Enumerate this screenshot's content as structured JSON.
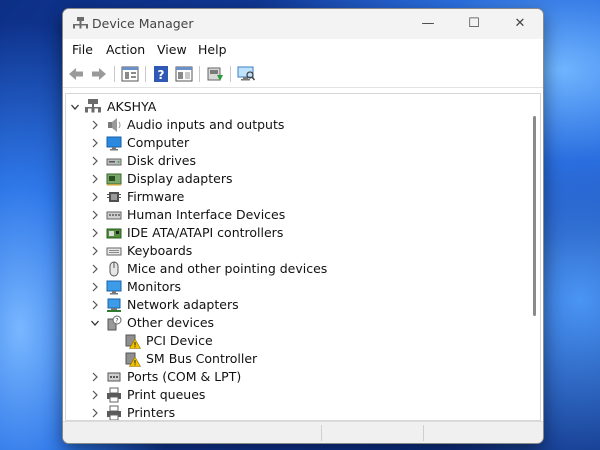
{
  "window": {
    "title": "Device Manager",
    "minimize": "—",
    "maximize": "☐",
    "close": "✕"
  },
  "menu": [
    "File",
    "Action",
    "View",
    "Help"
  ],
  "toolbar": {
    "buttons": [
      "back-icon",
      "forward-icon",
      "properties-icon",
      "help-icon",
      "details-icon",
      "update-driver-icon",
      "scan-hardware-icon"
    ]
  },
  "tree": {
    "root": "AKSHYA",
    "categories": [
      {
        "label": "Audio inputs and outputs",
        "icon": "speaker-icon",
        "expanded": false
      },
      {
        "label": "Computer",
        "icon": "computer-icon",
        "expanded": false
      },
      {
        "label": "Disk drives",
        "icon": "disk-drive-icon",
        "expanded": false
      },
      {
        "label": "Display adapters",
        "icon": "display-adapter-icon",
        "expanded": false
      },
      {
        "label": "Firmware",
        "icon": "firmware-icon",
        "expanded": false
      },
      {
        "label": "Human Interface Devices",
        "icon": "hid-icon",
        "expanded": false
      },
      {
        "label": "IDE ATA/ATAPI controllers",
        "icon": "ide-controller-icon",
        "expanded": false
      },
      {
        "label": "Keyboards",
        "icon": "keyboard-icon",
        "expanded": false
      },
      {
        "label": "Mice and other pointing devices",
        "icon": "mouse-icon",
        "expanded": false
      },
      {
        "label": "Monitors",
        "icon": "monitor-icon",
        "expanded": false
      },
      {
        "label": "Network adapters",
        "icon": "network-adapter-icon",
        "expanded": false
      },
      {
        "label": "Other devices",
        "icon": "unknown-device-icon",
        "expanded": true,
        "children": [
          {
            "label": "PCI Device",
            "icon": "warning-device-icon"
          },
          {
            "label": "SM Bus Controller",
            "icon": "warning-device-icon"
          }
        ]
      },
      {
        "label": "Ports (COM & LPT)",
        "icon": "port-icon",
        "expanded": false
      },
      {
        "label": "Print queues",
        "icon": "printer-icon",
        "expanded": false
      },
      {
        "label": "Printers",
        "icon": "printer-icon",
        "expanded": false
      }
    ]
  },
  "colors": {
    "accent": "#0a64c8",
    "warning": "#f2c200",
    "window_bg": "#ffffff",
    "titlebar_bg": "#f3f3f3"
  }
}
